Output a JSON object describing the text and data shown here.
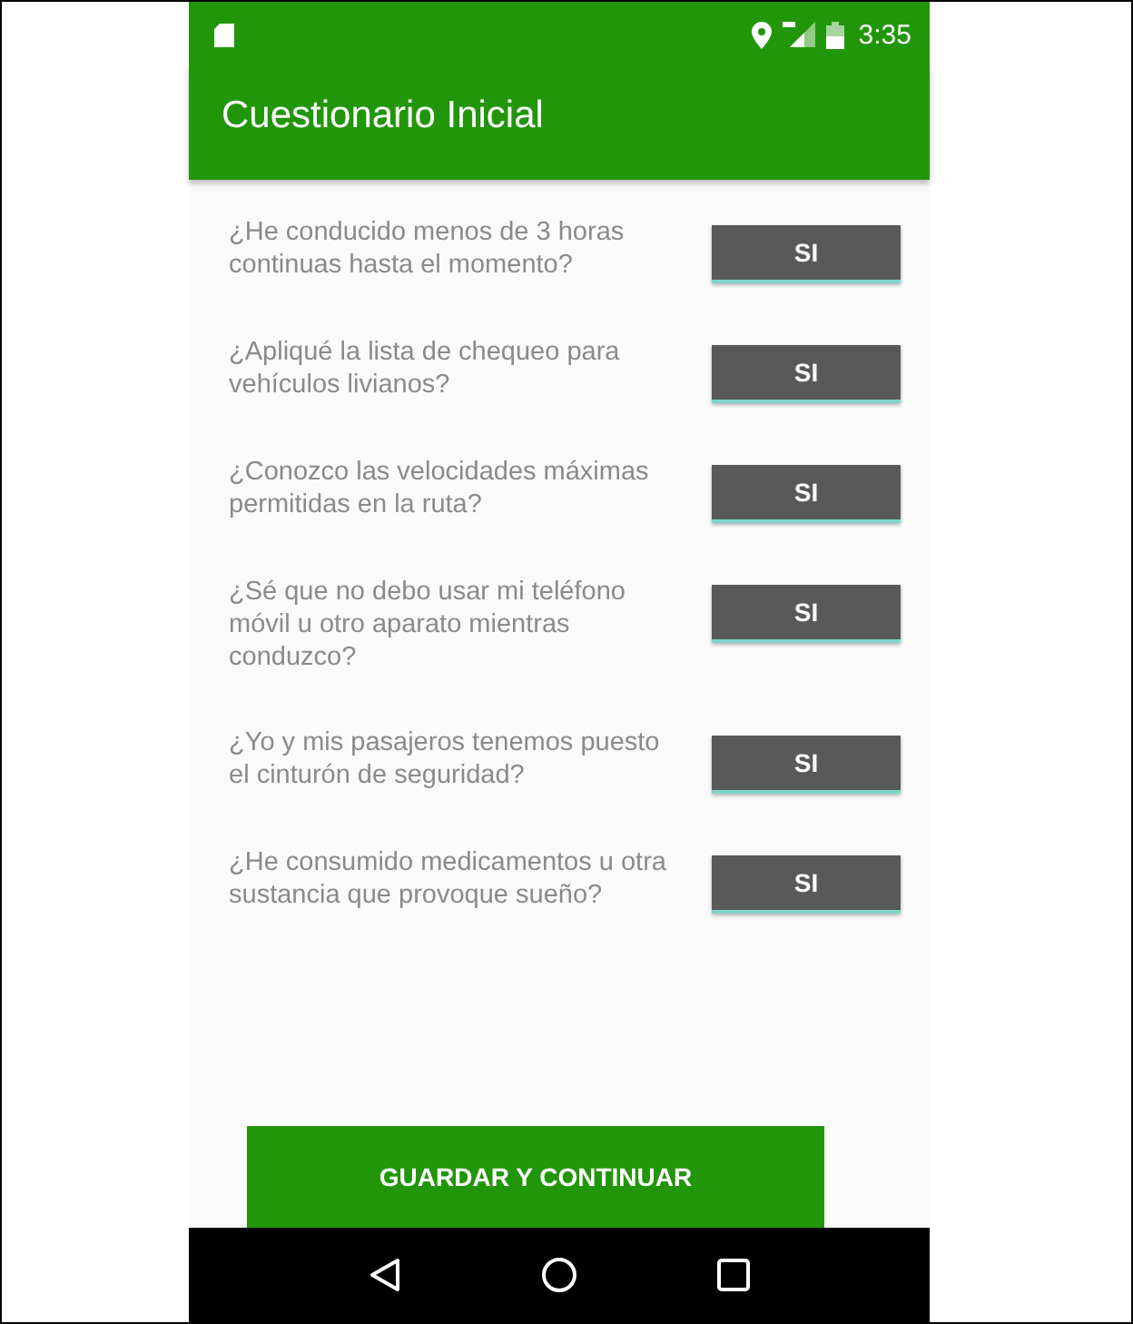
{
  "status_bar": {
    "time": "3:35"
  },
  "app_bar": {
    "title": "Cuestionario Inicial"
  },
  "questions": [
    {
      "text": "¿He conducido menos de 3 horas continuas hasta el momento?",
      "answer": "SI"
    },
    {
      "text": "¿Apliqué la lista de chequeo para vehículos livianos?",
      "answer": "SI"
    },
    {
      "text": "¿Conozco las velocidades máximas permitidas en la ruta?",
      "answer": "SI"
    },
    {
      "text": "¿Sé que no debo usar mi teléfono móvil u otro aparato mientras conduzco?",
      "answer": "SI"
    },
    {
      "text": "¿Yo y mis pasajeros tenemos puesto el cinturón de seguridad?",
      "answer": "SI"
    },
    {
      "text": "¿He consumido medicamentos u otra sustancia que provoque sueño?",
      "answer": "SI"
    }
  ],
  "submit_button": "GUARDAR Y CONTINUAR"
}
